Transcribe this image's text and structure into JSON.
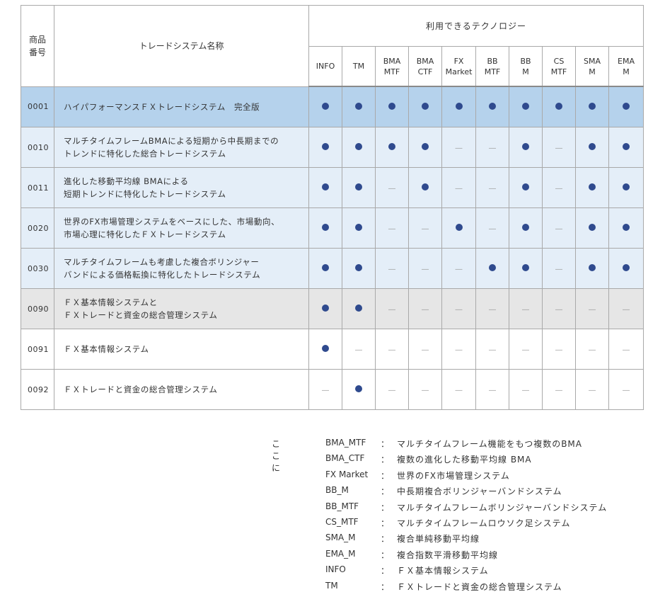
{
  "header": {
    "code_label_1": "商品",
    "code_label_2": "番号",
    "name_label": "トレードシステム名称",
    "tech_group_label": "利用できるテクノロジー",
    "tech_columns": [
      {
        "line1": "INFO",
        "line2": ""
      },
      {
        "line1": "TM",
        "line2": ""
      },
      {
        "line1": "BMA",
        "line2": "MTF"
      },
      {
        "line1": "BMA",
        "line2": "CTF"
      },
      {
        "line1": "FX",
        "line2": "Market"
      },
      {
        "line1": "BB",
        "line2": "MTF"
      },
      {
        "line1": "BB",
        "line2": "M"
      },
      {
        "line1": "CS",
        "line2": "MTF"
      },
      {
        "line1": "SMA",
        "line2": "M"
      },
      {
        "line1": "EMA",
        "line2": "M"
      }
    ]
  },
  "rows": [
    {
      "code": "0001",
      "name1": "ハイパフォーマンスＦＸトレードシステム　完全版",
      "name2": "",
      "style": "sel",
      "cells": [
        true,
        true,
        true,
        true,
        true,
        true,
        true,
        true,
        true,
        true
      ]
    },
    {
      "code": "0010",
      "name1": "マルチタイムフレームBMAによる短期から中長期までの",
      "name2": "トレンドに特化した総合トレードシステム",
      "style": "lt",
      "cells": [
        true,
        true,
        true,
        true,
        false,
        false,
        true,
        false,
        true,
        true
      ]
    },
    {
      "code": "0011",
      "name1": "進化した移動平均線 BMAによる",
      "name2": "短期トレンドに特化したトレードシステム",
      "style": "lt",
      "cells": [
        true,
        true,
        false,
        true,
        false,
        false,
        true,
        false,
        true,
        true
      ]
    },
    {
      "code": "0020",
      "name1": "世界のFX市場管理システムをベースにした、市場動向、",
      "name2": "市場心理に特化したＦＸトレードシステム",
      "style": "lt",
      "cells": [
        true,
        true,
        false,
        false,
        true,
        false,
        true,
        false,
        true,
        true
      ]
    },
    {
      "code": "0030",
      "name1": "マルチタイムフレームも考慮した複合ボリンジャー",
      "name2": "バンドによる価格転換に特化したトレードシステム",
      "style": "lt",
      "cells": [
        true,
        true,
        false,
        false,
        false,
        true,
        true,
        false,
        true,
        true
      ]
    },
    {
      "code": "0090",
      "name1": "ＦＸ基本情報システムと",
      "name2": "ＦＸトレードと資金の総合管理システム",
      "style": "gr",
      "cells": [
        true,
        true,
        false,
        false,
        false,
        false,
        false,
        false,
        false,
        false
      ]
    },
    {
      "code": "0091",
      "name1": "ＦＸ基本情報システム",
      "name2": "",
      "style": "wh",
      "cells": [
        true,
        false,
        false,
        false,
        false,
        false,
        false,
        false,
        false,
        false
      ]
    },
    {
      "code": "0092",
      "name1": "ＦＸトレードと資金の総合管理システム",
      "name2": "",
      "style": "wh",
      "cells": [
        false,
        true,
        false,
        false,
        false,
        false,
        false,
        false,
        false,
        false
      ]
    }
  ],
  "marks": {
    "present": "●",
    "absent": "―"
  },
  "legend": {
    "intro": "ここに",
    "items": [
      {
        "term": "BMA_MTF",
        "colon": "：",
        "desc": "マルチタイムフレーム機能をもつ複数のBMA"
      },
      {
        "term": "BMA_CTF",
        "colon": "：",
        "desc": "複数の進化した移動平均線 BMA"
      },
      {
        "term": "FX Market",
        "colon": "：",
        "desc": "世界のFX市場管理システム"
      },
      {
        "term": "BB_M",
        "colon": "：",
        "desc": "中長期複合ボリンジャーバンドシステム"
      },
      {
        "term": "BB_MTF",
        "colon": "：",
        "desc": "マルチタイムフレームボリンジャーバンドシステム"
      },
      {
        "term": "CS_MTF",
        "colon": "：",
        "desc": "マルチタイムフレームロウソク足システム"
      },
      {
        "term": "SMA_M",
        "colon": "：",
        "desc": "複合単純移動平均線"
      },
      {
        "term": "EMA_M",
        "colon": "：",
        "desc": "複合指数平滑移動平均線"
      },
      {
        "term": "INFO",
        "colon": "：",
        "desc": "ＦＸ基本情報システム"
      },
      {
        "term": "TM",
        "colon": "：",
        "desc": "ＦＸトレードと資金の総合管理システム"
      }
    ]
  }
}
